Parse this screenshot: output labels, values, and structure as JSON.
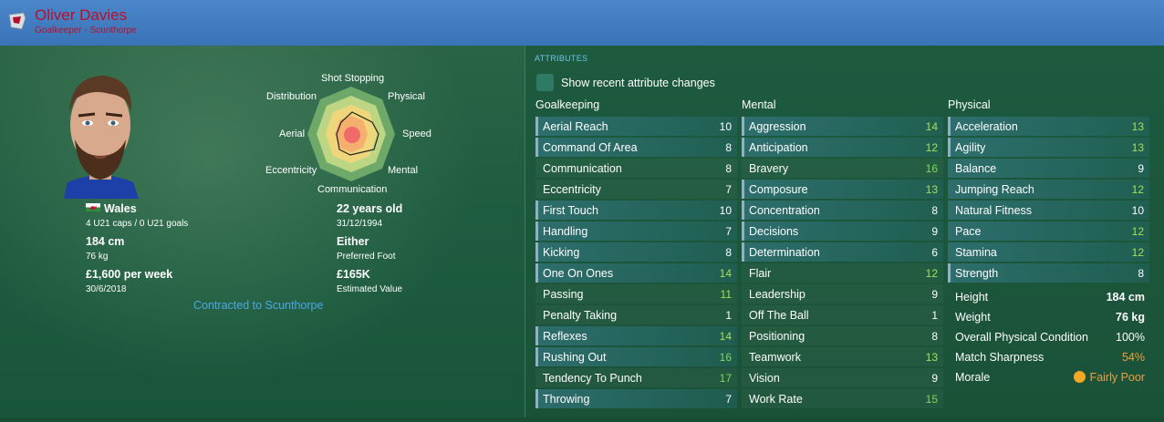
{
  "header": {
    "player_name": "Oliver Davies",
    "subtitle": "Goalkeeper - Scunthorpe"
  },
  "radar": {
    "labels": {
      "top": "Shot Stopping",
      "top_left": "Distribution",
      "top_right": "Physical",
      "left": "Aerial",
      "right": "Speed",
      "bottom_left": "Eccentricity",
      "bottom_right": "Mental",
      "bottom": "Communication"
    }
  },
  "player": {
    "nationality": "Wales",
    "caps": "4 U21 caps / 0 U21 goals",
    "height": "184 cm",
    "weight": "76 kg",
    "wage": "£1,600 per week",
    "contract_end": "30/6/2018",
    "age": "22 years old",
    "dob": "31/12/1994",
    "foot": "Either",
    "foot_label": "Preferred Foot",
    "value": "£165K",
    "value_label": "Estimated Value",
    "contracted": "Contracted to Scunthorpe"
  },
  "attributes": {
    "title": "ATTRIBUTES",
    "show_changes": "Show recent attribute changes",
    "goalkeeping_title": "Goalkeeping",
    "mental_title": "Mental",
    "physical_title": "Physical",
    "goalkeeping": [
      {
        "name": "Aerial Reach",
        "value": "10"
      },
      {
        "name": "Command Of Area",
        "value": "8"
      },
      {
        "name": "Communication",
        "value": "8"
      },
      {
        "name": "Eccentricity",
        "value": "7"
      },
      {
        "name": "First Touch",
        "value": "10"
      },
      {
        "name": "Handling",
        "value": "7"
      },
      {
        "name": "Kicking",
        "value": "8"
      },
      {
        "name": "One On Ones",
        "value": "14"
      },
      {
        "name": "Passing",
        "value": "11"
      },
      {
        "name": "Penalty Taking",
        "value": "1"
      },
      {
        "name": "Reflexes",
        "value": "14"
      },
      {
        "name": "Rushing Out",
        "value": "16"
      },
      {
        "name": "Tendency To Punch",
        "value": "17"
      },
      {
        "name": "Throwing",
        "value": "7"
      }
    ],
    "mental": [
      {
        "name": "Aggression",
        "value": "14"
      },
      {
        "name": "Anticipation",
        "value": "12"
      },
      {
        "name": "Bravery",
        "value": "16"
      },
      {
        "name": "Composure",
        "value": "13"
      },
      {
        "name": "Concentration",
        "value": "8"
      },
      {
        "name": "Decisions",
        "value": "9"
      },
      {
        "name": "Determination",
        "value": "6"
      },
      {
        "name": "Flair",
        "value": "12"
      },
      {
        "name": "Leadership",
        "value": "9"
      },
      {
        "name": "Off The Ball",
        "value": "1"
      },
      {
        "name": "Positioning",
        "value": "8"
      },
      {
        "name": "Teamwork",
        "value": "13"
      },
      {
        "name": "Vision",
        "value": "9"
      },
      {
        "name": "Work Rate",
        "value": "15"
      }
    ],
    "physical": [
      {
        "name": "Acceleration",
        "value": "13"
      },
      {
        "name": "Agility",
        "value": "13"
      },
      {
        "name": "Balance",
        "value": "9"
      },
      {
        "name": "Jumping Reach",
        "value": "12"
      },
      {
        "name": "Natural Fitness",
        "value": "10"
      },
      {
        "name": "Pace",
        "value": "12"
      },
      {
        "name": "Stamina",
        "value": "12"
      },
      {
        "name": "Strength",
        "value": "8"
      }
    ],
    "extra": [
      {
        "name": "Height",
        "value": "184 cm"
      },
      {
        "name": "Weight",
        "value": "76 kg"
      },
      {
        "name": "Overall Physical Condition",
        "value": "100%"
      },
      {
        "name": "Match Sharpness",
        "value": "54%"
      },
      {
        "name": "Morale",
        "value": "Fairly Poor"
      }
    ]
  },
  "colors": {
    "header": "#3a74b8",
    "name": "#b8102a",
    "good": "#7ed957",
    "warning": "#f0a040",
    "link": "#4aa8e6"
  }
}
